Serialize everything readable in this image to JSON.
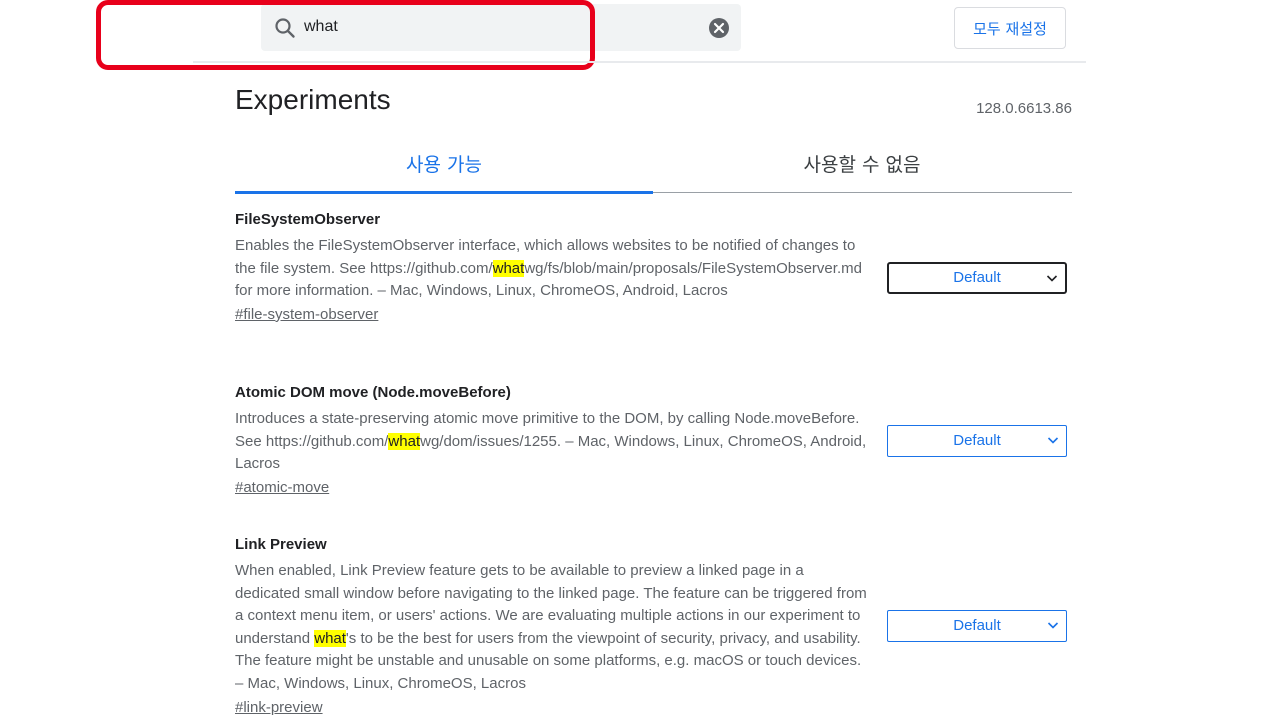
{
  "header": {
    "search_value": "what",
    "reset_all_label": "모두 재설정"
  },
  "page": {
    "title": "Experiments",
    "version": "128.0.6613.86"
  },
  "tabs": [
    {
      "label": "사용 가능",
      "active": true
    },
    {
      "label": "사용할 수 없음",
      "active": false
    }
  ],
  "experiments": [
    {
      "title": "FileSystemObserver",
      "desc_parts": [
        "Enables the FileSystemObserver interface, which allows websites to be notified of changes to the file system. See https://github.com/",
        "what",
        "wg/fs/blob/main/proposals/FileSystemObserver.md for more information. – Mac, Windows, Linux, ChromeOS, Android, Lacros"
      ],
      "link": "#file-system-observer",
      "select_value": "Default"
    },
    {
      "title": "Atomic DOM move (Node.moveBefore)",
      "desc_parts": [
        "Introduces a state-preserving atomic move primitive to the DOM, by calling Node.moveBefore. See https://github.com/",
        "what",
        "wg/dom/issues/1255. – Mac, Windows, Linux, ChromeOS, Android, Lacros"
      ],
      "link": "#atomic-move",
      "select_value": "Default"
    },
    {
      "title": "Link Preview",
      "desc_parts": [
        "When enabled, Link Preview feature gets to be available to preview a linked page in a dedicated small window before navigating to the linked page. The feature can be triggered from a context menu item, or users' actions. We are evaluating multiple actions in our experiment to understand ",
        "what",
        "'s to be the best for users from the viewpoint of security, privacy, and usability. The feature might be unstable and unusable on some platforms, e.g. macOS or touch devices. – Mac, Windows, Linux, ChromeOS, Lacros"
      ],
      "link": "#link-preview",
      "select_value": "Default"
    }
  ],
  "colors": {
    "accent": "#1a73e8",
    "highlight": "#ffff00",
    "annotation_box": "#e8001b"
  },
  "icons": {
    "search": "search-icon",
    "clear": "clear-icon",
    "dropdown": "chevron-down-icon"
  }
}
